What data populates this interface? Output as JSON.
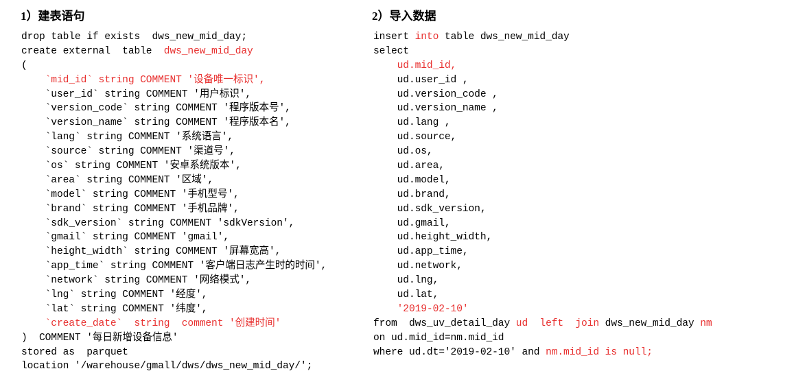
{
  "colors": {
    "text_black": "#000000",
    "keyword_red": "#e8302f",
    "background": "#ffffff"
  },
  "left_column": {
    "heading": "1）建表语句",
    "lines": [
      [
        {
          "t": "drop table if exists  dws_new_mid_day;",
          "c": "black"
        }
      ],
      [
        {
          "t": "create external  table  ",
          "c": "black"
        },
        {
          "t": "dws_new_mid_day",
          "c": "red"
        }
      ],
      [
        {
          "t": "(",
          "c": "black"
        }
      ],
      [
        {
          "t": "    `mid_id` string COMMENT '设备唯一标识',",
          "c": "red"
        }
      ],
      [
        {
          "t": "    `user_id` string COMMENT '用户标识',",
          "c": "black"
        }
      ],
      [
        {
          "t": "    `version_code` string COMMENT '程序版本号',",
          "c": "black"
        }
      ],
      [
        {
          "t": "    `version_name` string COMMENT '程序版本名',",
          "c": "black"
        }
      ],
      [
        {
          "t": "    `lang` string COMMENT '系统语言',",
          "c": "black"
        }
      ],
      [
        {
          "t": "    `source` string COMMENT '渠道号',",
          "c": "black"
        }
      ],
      [
        {
          "t": "    `os` string COMMENT '安卓系统版本',",
          "c": "black"
        }
      ],
      [
        {
          "t": "    `area` string COMMENT '区域',",
          "c": "black"
        }
      ],
      [
        {
          "t": "    `model` string COMMENT '手机型号',",
          "c": "black"
        }
      ],
      [
        {
          "t": "    `brand` string COMMENT '手机品牌',",
          "c": "black"
        }
      ],
      [
        {
          "t": "    `sdk_version` string COMMENT 'sdkVersion',",
          "c": "black"
        }
      ],
      [
        {
          "t": "    `gmail` string COMMENT 'gmail',",
          "c": "black"
        }
      ],
      [
        {
          "t": "    `height_width` string COMMENT '屏幕宽高',",
          "c": "black"
        }
      ],
      [
        {
          "t": "    `app_time` string COMMENT '客户端日志产生时的时间',",
          "c": "black"
        }
      ],
      [
        {
          "t": "    `network` string COMMENT '网络模式',",
          "c": "black"
        }
      ],
      [
        {
          "t": "    `lng` string COMMENT '经度',",
          "c": "black"
        }
      ],
      [
        {
          "t": "    `lat` string COMMENT '纬度',",
          "c": "black"
        }
      ],
      [
        {
          "t": "    `create_date`  string  comment '创建时间'",
          "c": "red"
        }
      ],
      [
        {
          "t": ")  COMMENT '每日新增设备信息'",
          "c": "black"
        }
      ],
      [
        {
          "t": "stored as  parquet",
          "c": "black"
        }
      ],
      [
        {
          "t": "location '/warehouse/gmall/dws/dws_new_mid_day/';",
          "c": "black"
        }
      ]
    ]
  },
  "right_column": {
    "heading": "2）导入数据",
    "lines": [
      [
        {
          "t": "insert ",
          "c": "black"
        },
        {
          "t": "into",
          "c": "red"
        },
        {
          "t": " table dws_new_mid_day",
          "c": "black"
        }
      ],
      [
        {
          "t": "select",
          "c": "black"
        }
      ],
      [
        {
          "t": "    ud.mid_id,",
          "c": "red"
        }
      ],
      [
        {
          "t": "    ud.user_id ,",
          "c": "black"
        }
      ],
      [
        {
          "t": "    ud.version_code ,",
          "c": "black"
        }
      ],
      [
        {
          "t": "    ud.version_name ,",
          "c": "black"
        }
      ],
      [
        {
          "t": "    ud.lang ,",
          "c": "black"
        }
      ],
      [
        {
          "t": "    ud.source,",
          "c": "black"
        }
      ],
      [
        {
          "t": "    ud.os,",
          "c": "black"
        }
      ],
      [
        {
          "t": "    ud.area,",
          "c": "black"
        }
      ],
      [
        {
          "t": "    ud.model,",
          "c": "black"
        }
      ],
      [
        {
          "t": "    ud.brand,",
          "c": "black"
        }
      ],
      [
        {
          "t": "    ud.sdk_version,",
          "c": "black"
        }
      ],
      [
        {
          "t": "    ud.gmail,",
          "c": "black"
        }
      ],
      [
        {
          "t": "    ud.height_width,",
          "c": "black"
        }
      ],
      [
        {
          "t": "    ud.app_time,",
          "c": "black"
        }
      ],
      [
        {
          "t": "    ud.network,",
          "c": "black"
        }
      ],
      [
        {
          "t": "    ud.lng,",
          "c": "black"
        }
      ],
      [
        {
          "t": "    ud.lat,",
          "c": "black"
        }
      ],
      [
        {
          "t": "    '2019-02-10'",
          "c": "red"
        }
      ],
      [
        {
          "t": "from  dws_uv_detail_day ",
          "c": "black"
        },
        {
          "t": "ud  left  join",
          "c": "red"
        },
        {
          "t": " dws_new_mid_day ",
          "c": "black"
        },
        {
          "t": "nm",
          "c": "red"
        }
      ],
      [
        {
          "t": "on ud.mid_id=nm.mid_id",
          "c": "black"
        }
      ],
      [
        {
          "t": "where ud.dt='2019-02-10' and ",
          "c": "black"
        },
        {
          "t": "nm.mid_id is null;",
          "c": "red"
        }
      ]
    ]
  }
}
